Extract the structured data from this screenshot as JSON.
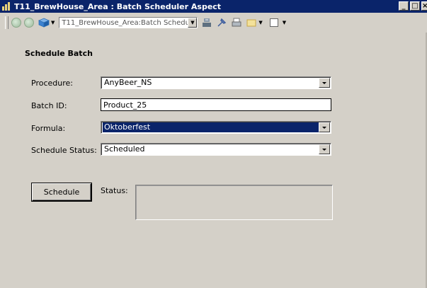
{
  "window": {
    "title": "T11_BrewHouse_Area : Batch Scheduler Aspect",
    "buttons": {
      "minimize": "_",
      "maximize": "□",
      "close": "×"
    }
  },
  "toolbar": {
    "path_value": "T11_BrewHouse_Area:Batch Schedu",
    "icons": [
      "back-icon",
      "forward-icon",
      "object-cube-icon",
      "scale-icon",
      "pin-icon",
      "printer-icon",
      "overlay-icon",
      "window-icon"
    ]
  },
  "form": {
    "section_title": "Schedule Batch",
    "procedure": {
      "label": "Procedure:",
      "value": "AnyBeer_NS"
    },
    "batch_id": {
      "label": "Batch ID:",
      "value": "Product_25"
    },
    "formula": {
      "label": "Formula:",
      "value": "Oktoberfest"
    },
    "schedule_status": {
      "label": "Schedule Status:",
      "value": "Scheduled"
    },
    "schedule_button": "Schedule",
    "status_label": "Status:",
    "status_text": ""
  },
  "colors": {
    "titlebar": "#0a246a",
    "face": "#d4d0c8",
    "selection": "#0a246a"
  }
}
